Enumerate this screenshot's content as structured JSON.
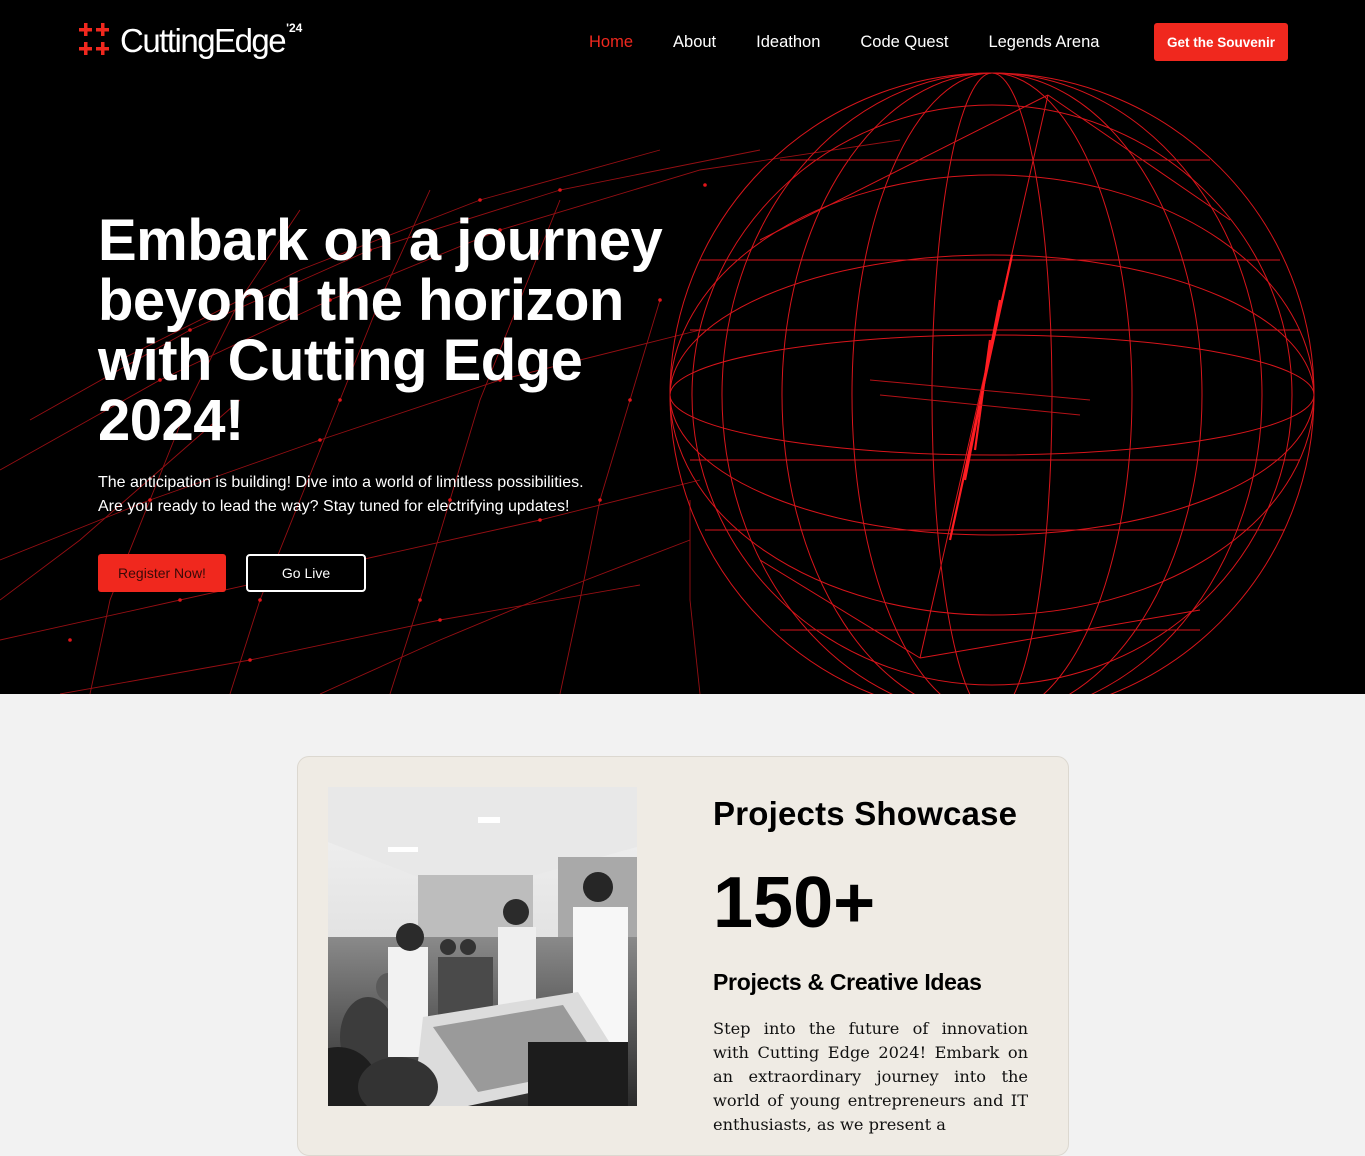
{
  "nav": {
    "logo_text": "CuttingEdge",
    "logo_sup": "'24",
    "links": [
      {
        "label": "Home",
        "active": true
      },
      {
        "label": "About",
        "active": false
      },
      {
        "label": "Ideathon",
        "active": false
      },
      {
        "label": "Code Quest",
        "active": false
      },
      {
        "label": "Legends Arena",
        "active": false
      }
    ],
    "cta_label": "Get the Souvenir"
  },
  "hero": {
    "title": "Embark on a journey beyond the horizon with Cutting Edge 2024!",
    "subtitle_line1": "The anticipation is building! Dive into a world of limitless possibilities.",
    "subtitle_line2": "Are you ready to lead the way? Stay tuned for electrifying updates!",
    "register_label": "Register Now!",
    "live_label": "Go Live"
  },
  "showcase": {
    "title": "Projects Showcase",
    "count": "150+",
    "subtitle": "Projects & Creative Ideas",
    "description": "Step into the future of innovation with Cutting Edge 2024! Embark on an extraordinary journey into the world of young entrepreneurs and IT enthusiasts, as we present a"
  },
  "colors": {
    "accent": "#f0281e",
    "hero_bg": "#000000",
    "card_bg": "#efebe4",
    "page_bg": "#f2f2f2"
  },
  "icons": {
    "logo": "grid-hash-icon",
    "hero_art": "wireframe-globe"
  }
}
